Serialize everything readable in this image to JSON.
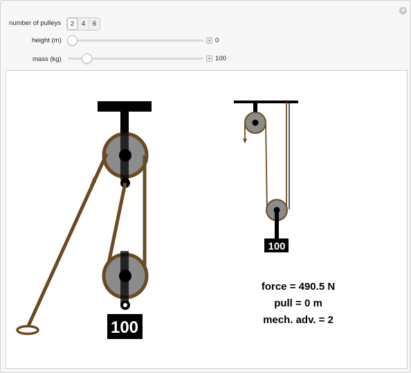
{
  "controls": {
    "pulleys": {
      "label": "number of pulleys",
      "options": [
        "2",
        "4",
        "6"
      ],
      "selected": "2"
    },
    "height": {
      "label": "height (m)",
      "value": "0",
      "fraction": 0.0
    },
    "mass": {
      "label": "mass (kg)",
      "value": "100",
      "fraction": 0.11
    }
  },
  "figure": {
    "left_mass_label": "100",
    "right_mass_label": "100",
    "results": {
      "force": "force = 490.5 N",
      "pull": "pull = 0 m",
      "mech_adv": "mech. adv. = 2"
    }
  },
  "colors": {
    "rope": "#6b4a22",
    "pulley": "#8c8c8c",
    "black": "#000000"
  }
}
